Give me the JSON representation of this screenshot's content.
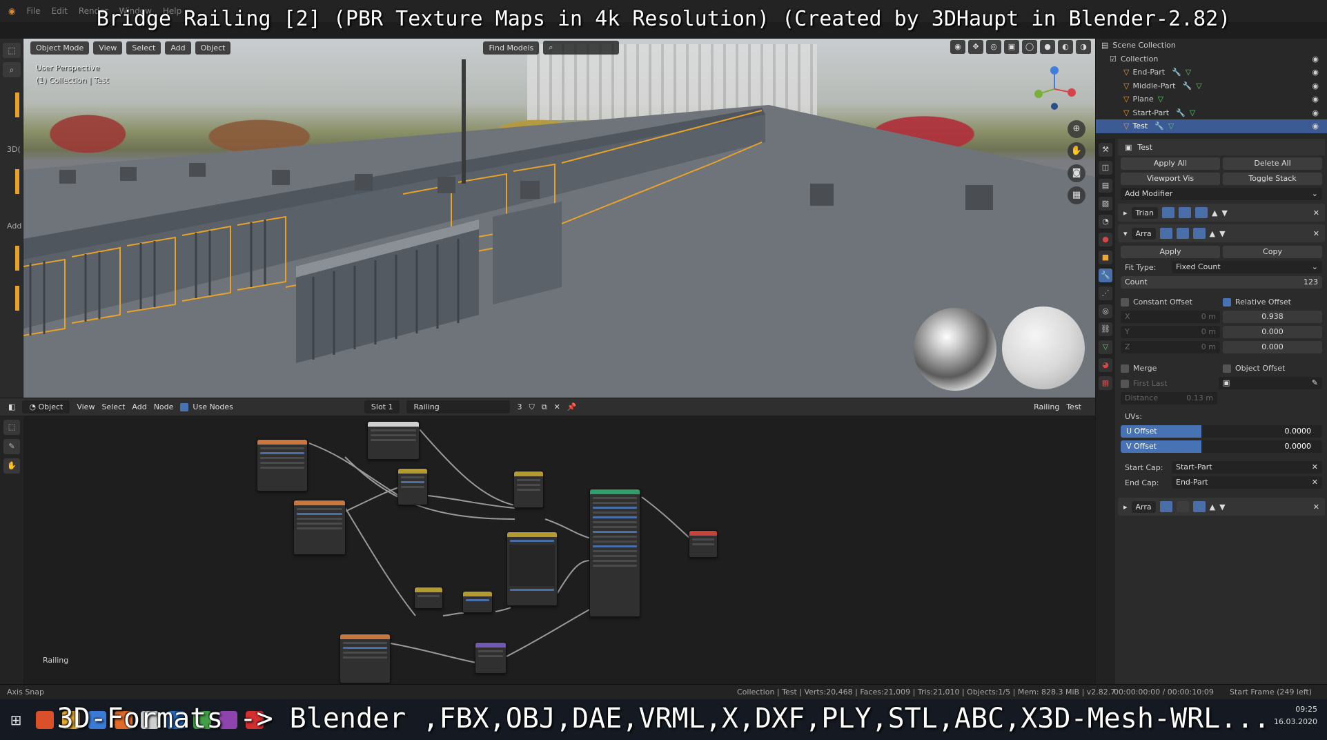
{
  "overlay": {
    "title": "Bridge Railing [2] (PBR Texture Maps in 4k Resolution) (Created by 3DHaupt in Blender-2.82)",
    "bottom": "3D-Formats -> Blender ,FBX,OBJ,DAE,VRML,X,DXF,PLY,STL,ABC,X3D-Mesh-WRL..."
  },
  "menu": [
    "File",
    "Edit",
    "Render",
    "Window",
    "Help"
  ],
  "viewport": {
    "mode": "Object Mode",
    "menus": [
      "View",
      "Select",
      "Add",
      "Object"
    ],
    "search": "Find Models",
    "info_line1": "User Perspective",
    "info_line2": "(1) Collection | Test"
  },
  "lefttools": {
    "label1": "3D(",
    "label2": "Add"
  },
  "outliner": {
    "root": "Scene Collection",
    "collection": "Collection",
    "items": [
      "End-Part",
      "Middle-Part",
      "Plane",
      "Start-Part",
      "Test"
    ],
    "selected": "Test"
  },
  "props": {
    "object_name": "Test",
    "apply_all": "Apply All",
    "delete_all": "Delete All",
    "viewport_vis": "Viewport Vis",
    "toggle_stack": "Toggle Stack",
    "add_modifier": "Add Modifier",
    "mod1": "Trian",
    "mod2": "Arra",
    "mod3": "Arra",
    "apply": "Apply",
    "copy": "Copy",
    "fit_type_label": "Fit Type:",
    "fit_type_value": "Fixed Count",
    "count_label": "Count",
    "count_value": "123",
    "constant_offset": "Constant Offset",
    "relative_offset": "Relative Offset",
    "x_label": "X",
    "y_label": "Y",
    "z_label": "Z",
    "const_x": "0 m",
    "const_y": "0 m",
    "const_z": "0 m",
    "rel_x": "0.938",
    "rel_y": "0.000",
    "rel_z": "0.000",
    "merge": "Merge",
    "object_offset": "Object Offset",
    "first_last": "First Last",
    "distance_label": "Distance",
    "distance_value": "0.13 m",
    "uvs": "UVs:",
    "u_offset": "U Offset",
    "u_value": "0.0000",
    "v_offset": "V Offset",
    "v_value": "0.0000",
    "start_cap_label": "Start Cap:",
    "start_cap": "Start-Part",
    "end_cap_label": "End Cap:",
    "end_cap": "End-Part"
  },
  "node_editor": {
    "object": "Object",
    "menus": [
      "View",
      "Select",
      "Add",
      "Node"
    ],
    "use_nodes": "Use Nodes",
    "slot": "Slot 1",
    "material": "Railing",
    "users": "3",
    "mat_right": "Railing",
    "obj_right": "Test",
    "caption": "Railing"
  },
  "status": {
    "left": "Axis Snap",
    "mid": "Collection | Test | Verts:20,468 | Faces:21,009 | Tris:21,010 | Objects:1/5 | Mem: 828.3 MiB | v2.82.7",
    "time": "00:00:00:00 / 00:00:10:09",
    "start_frame": "Start Frame (249 left)"
  },
  "taskbar": {
    "time": "09:25",
    "date": "16.03.2020"
  },
  "colors": {
    "accent": "#4772b3",
    "selection": "#e7a22c",
    "selected_row": "#3c5a94"
  }
}
